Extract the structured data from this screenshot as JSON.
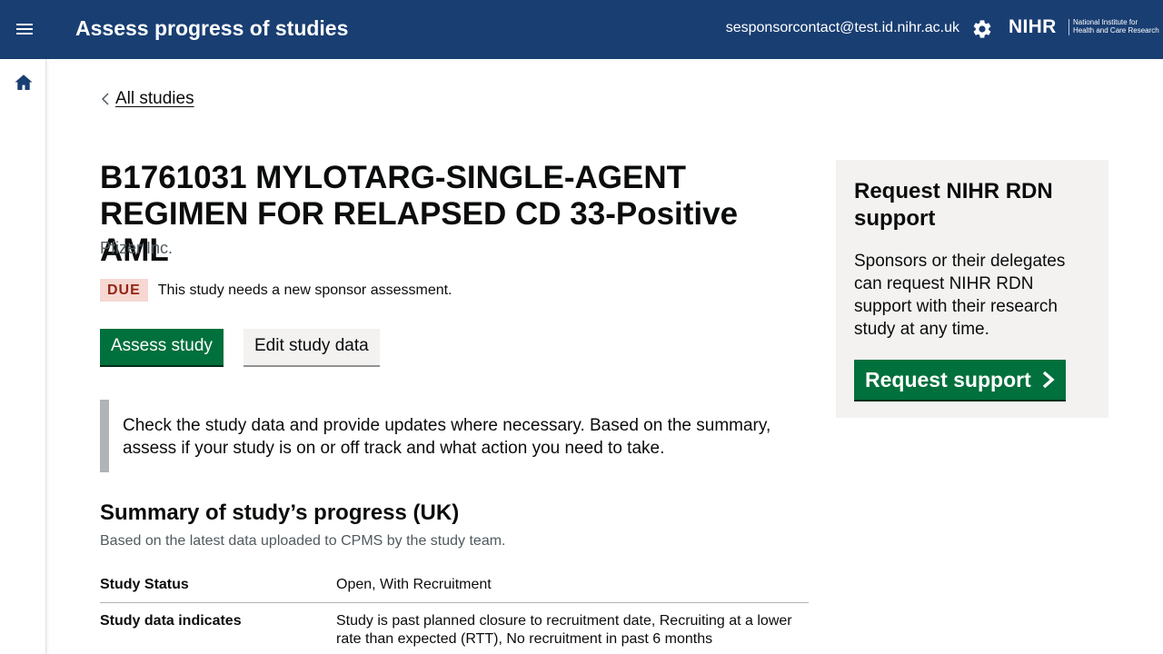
{
  "header": {
    "app_title": "Assess progress of studies",
    "user_email": "sesponsorcontact@test.id.nihr.ac.uk",
    "logo_word": "NIHR",
    "logo_sub_line1": "National Institute for",
    "logo_sub_line2": "Health and Care Research",
    "menu_icon": "hamburger-menu-icon",
    "settings_icon": "gear-icon"
  },
  "sidebar": {
    "home_icon": "home-icon"
  },
  "breadcrumb": {
    "back_label": "All studies"
  },
  "study": {
    "title": "B1761031 MYLOTARG-SINGLE-AGENT REGIMEN FOR RELAPSED CD 33-Positive AML",
    "sponsor": "Pfizer Inc.",
    "status_tag": "DUE",
    "status_message": "This study needs a new sponsor assessment."
  },
  "actions": {
    "assess_label": "Assess study",
    "edit_label": "Edit study data"
  },
  "inset_text": "Check the study data and provide updates where necessary. Based on the summary, assess if your study is on or off track and what action you need to take.",
  "summary": {
    "heading": "Summary of study’s progress (UK)",
    "subheading": "Based on the latest data uploaded to CPMS by the study team.",
    "rows": [
      {
        "key": "Study Status",
        "value": "Open, With Recruitment"
      },
      {
        "key": "Study data indicates",
        "value": "Study is past planned closure to recruitment date, Recruiting at a lower rate than expected (RTT), No recruitment in past 6 months"
      }
    ]
  },
  "aside": {
    "heading": "Request NIHR RDN support",
    "body": "Sponsors or their delegates can request NIHR RDN support with their research study at any time.",
    "button_label": "Request support"
  },
  "colors": {
    "header_bg": "#193e72",
    "primary_green": "#00703c",
    "due_tag_bg": "#f6d7d2",
    "due_tag_text": "#942514",
    "inset_border": "#b1b4b6",
    "aside_bg": "#f3f2f1"
  }
}
